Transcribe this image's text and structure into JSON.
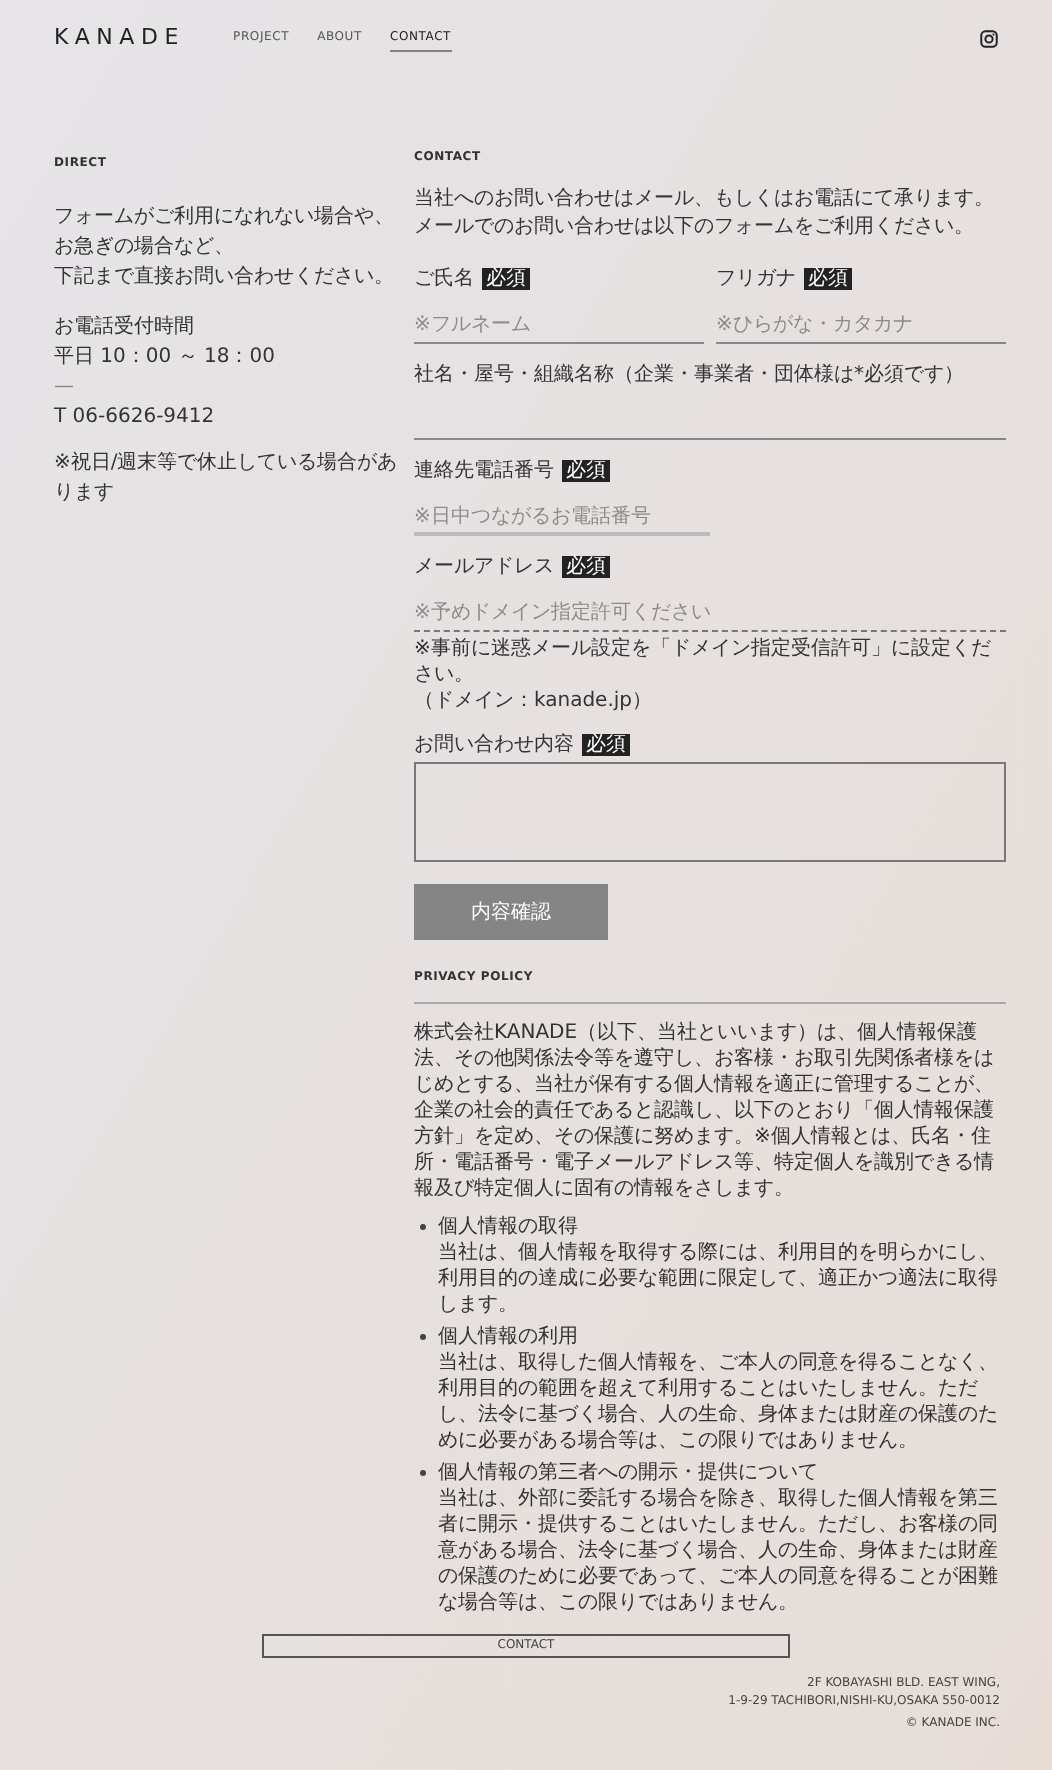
{
  "header": {
    "logo": "KANADE",
    "nav": [
      {
        "label": "PROJECT",
        "selected": false
      },
      {
        "label": "ABOUT",
        "selected": false
      },
      {
        "label": "CONTACT",
        "selected": true
      }
    ]
  },
  "direct": {
    "heading": "DIRECT",
    "lines": [
      "フォームがご利用になれない場合や、",
      "お急ぎの場合など、",
      "下記まで直接お問い合わせください。"
    ],
    "hours_label": "お電話受付時間",
    "hours": "平日 10：00 ～ 18：00",
    "dash": "—",
    "phone": "T 06-6626-9412",
    "note": "※祝日/週末等で休止している場合があります"
  },
  "contact": {
    "heading": "CONTACT",
    "intro": [
      "当社へのお問い合わせはメール、もしくはお電話にて承ります。",
      "メールでのお問い合わせは以下のフォームをご利用ください。"
    ],
    "rows": [
      [
        {
          "kind": "input",
          "label": "ご氏名",
          "badge": "必須",
          "placeholder": "※フルネーム"
        },
        {
          "kind": "input",
          "label": "フリガナ",
          "badge": "必須",
          "placeholder": "※ひらがな・カタカナ"
        }
      ],
      [
        {
          "kind": "input",
          "label": "社名・屋号・組織名称（企業・事業者・団体様は*必須です）"
        }
      ],
      [
        {
          "kind": "half",
          "label": "連絡先電話番号",
          "badge": "必須",
          "placeholder": "※日中つながるお電話番号"
        }
      ],
      [
        {
          "kind": "dashed",
          "label": "メールアドレス",
          "badge": "必須",
          "placeholder": "※予めドメイン指定許可ください",
          "note": [
            "※事前に迷惑メール設定を「ドメイン指定受信許可」に設定ください。",
            "（ドメイン：kanade.jp）"
          ]
        }
      ],
      [
        {
          "kind": "textarea",
          "label": "お問い合わせ内容",
          "badge": "必須"
        }
      ]
    ],
    "submit": "内容確認"
  },
  "privacy": {
    "heading": "PRIVACY POLICY",
    "body": "株式会社KANADE（以下、当社といいます）は、個人情報保護法、その他関係法令等を遵守し、お客様・お取引先関係者様をはじめとする、当社が保有する個人情報を適正に管理することが、企業の社会的責任であると認識し、以下のとおり「個人情報保護方針」を定め、その保護に努めます。※個人情報とは、氏名・住所・電話番号・電子メールアドレス等、特定個人を識別できる情報及び特定個人に固有の情報をさします。",
    "items": [
      {
        "title": "個人情報の取得",
        "text": "当社は、個人情報を取得する際には、利用目的を明らかにし、利用目的の達成に必要な範囲に限定して、適正かつ適法に取得します。"
      },
      {
        "title": "個人情報の利用",
        "text": "当社は、取得した個人情報を、ご本人の同意を得ることなく、利用目的の範囲を超えて利用することはいたしません。ただし、法令に基づく場合、人の生命、身体または財産の保護のために必要がある場合等は、この限りではありません。"
      },
      {
        "title": "個人情報の第三者への開示・提供について",
        "text": "当社は、外部に委託する場合を除き、取得した個人情報を第三者に開示・提供することはいたしません。ただし、お客様の同意がある場合、法令に基づく場合、人の生命、身体または財産の保護のために必要であって、ご本人の同意を得ることが困難な場合等は、この限りではありません。"
      }
    ]
  },
  "footer": {
    "button": "CONTACT",
    "address": [
      "2F KOBAYASHI BLD. EAST WING,",
      "1-9-29 TACHIBORI,NISHI-KU,OSAKA 550-0012"
    ],
    "copyright": "© KANADE INC."
  }
}
